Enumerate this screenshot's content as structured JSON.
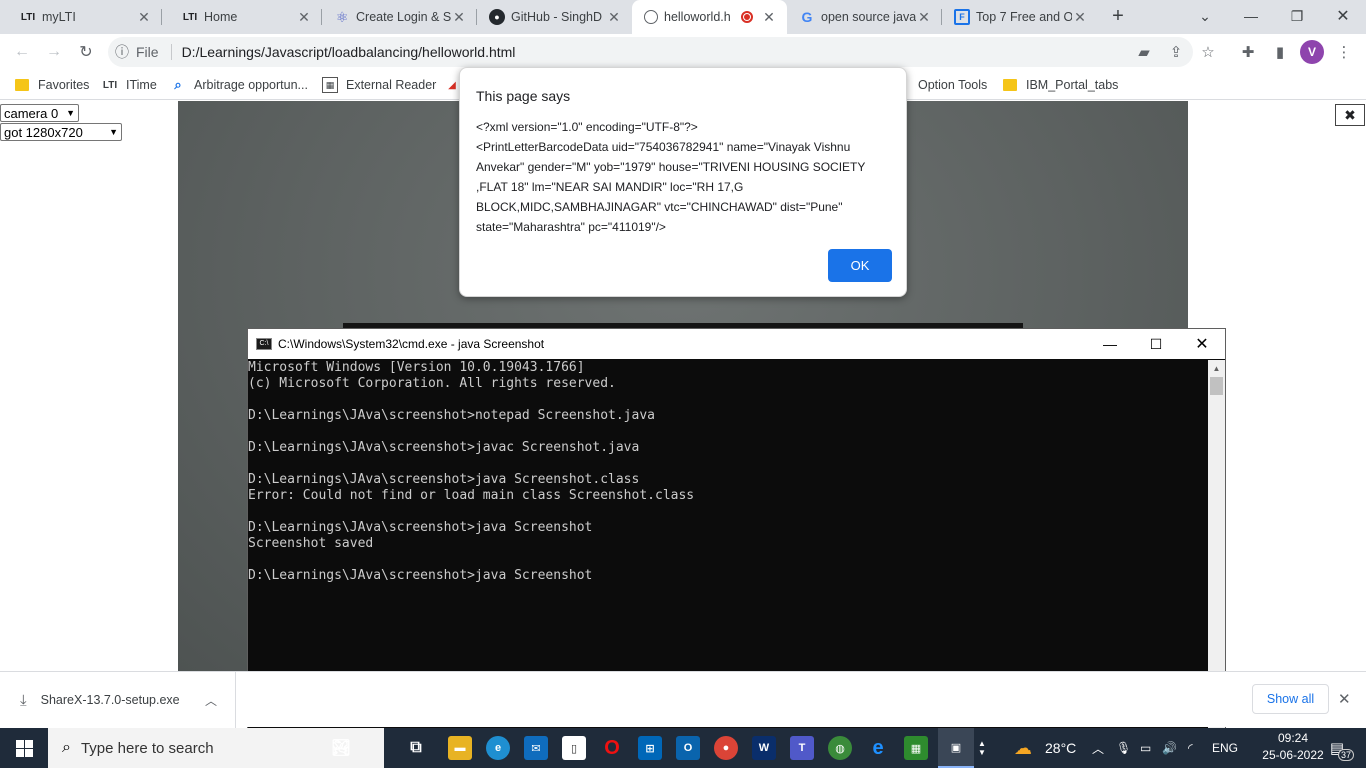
{
  "browser": {
    "tabs": [
      {
        "favicon": "LTI",
        "title": "myLTI"
      },
      {
        "favicon": "LTI",
        "title": "Home"
      },
      {
        "favicon": "react-icon",
        "title": "Create Login & S"
      },
      {
        "favicon": "github-icon",
        "title": "GitHub - SinghD"
      },
      {
        "favicon": "page-icon",
        "title": "helloworld.h",
        "active": true,
        "recording": true
      },
      {
        "favicon": "google-icon",
        "title": "open source java"
      },
      {
        "favicon": "doc-icon",
        "title": "Top 7 Free and O"
      }
    ],
    "new_tab": "+",
    "address": {
      "scheme": "File",
      "url": "D:/Learnings/Javascript/loadbalancing/helloworld.html"
    },
    "avatar_initial": "V",
    "bookmarks": [
      {
        "icon": "star-folder",
        "label": "Favorites"
      },
      {
        "icon": "LTI",
        "label": "ITime"
      },
      {
        "icon": "search-icon",
        "label": "Arbitrage opportun..."
      },
      {
        "icon": "reader-icon",
        "label": "External Reader"
      },
      {
        "icon": "folder",
        "label": "Option Tools"
      },
      {
        "icon": "folder",
        "label": "IBM_Portal_tabs"
      }
    ]
  },
  "page": {
    "camera_select": "camera 0",
    "resolution_select": "got 1280x720",
    "close_mark": "✖"
  },
  "alert": {
    "title": "This page says",
    "message": "<?xml version=\"1.0\" encoding=\"UTF-8\"?>\n<PrintLetterBarcodeData uid=\"754036782941\" name=\"Vinayak Vishnu Anvekar\" gender=\"M\" yob=\"1979\" house=\"TRIVENI HOUSING SOCIETY ,FLAT 18\" lm=\"NEAR SAI MANDIR\" loc=\"RH 17,G BLOCK,MIDC,SAMBHAJINAGAR\" vtc=\"CHINCHAWAD\" dist=\"Pune\" state=\"Maharashtra\" pc=\"411019\"/>",
    "ok_label": "OK"
  },
  "cmd": {
    "title": "C:\\Windows\\System32\\cmd.exe - java  Screenshot",
    "lines": [
      "Microsoft Windows [Version 10.0.19043.1766]",
      "(c) Microsoft Corporation. All rights reserved.",
      "",
      "D:\\Learnings\\JAva\\screenshot>notepad Screenshot.java",
      "",
      "D:\\Learnings\\JAva\\screenshot>javac Screenshot.java",
      "",
      "D:\\Learnings\\JAva\\screenshot>java Screenshot.class",
      "Error: Could not find or load main class Screenshot.class",
      "",
      "D:\\Learnings\\JAva\\screenshot>java Screenshot",
      "Screenshot saved",
      "",
      "D:\\Learnings\\JAva\\screenshot>java Screenshot"
    ]
  },
  "download": {
    "filename": "ShareX-13.7.0-setup.exe",
    "show_all": "Show all"
  },
  "taskbar": {
    "search_placeholder": "Type here to search",
    "weather": "28°C",
    "language": "ENG",
    "time": "09:24",
    "date": "25-06-2022",
    "notifications": "37"
  },
  "colors": {
    "accent": "#1a73e8",
    "taskbar": "#1f2b3a",
    "console_bg": "#0c0c0c",
    "console_text": "#cccccc"
  }
}
